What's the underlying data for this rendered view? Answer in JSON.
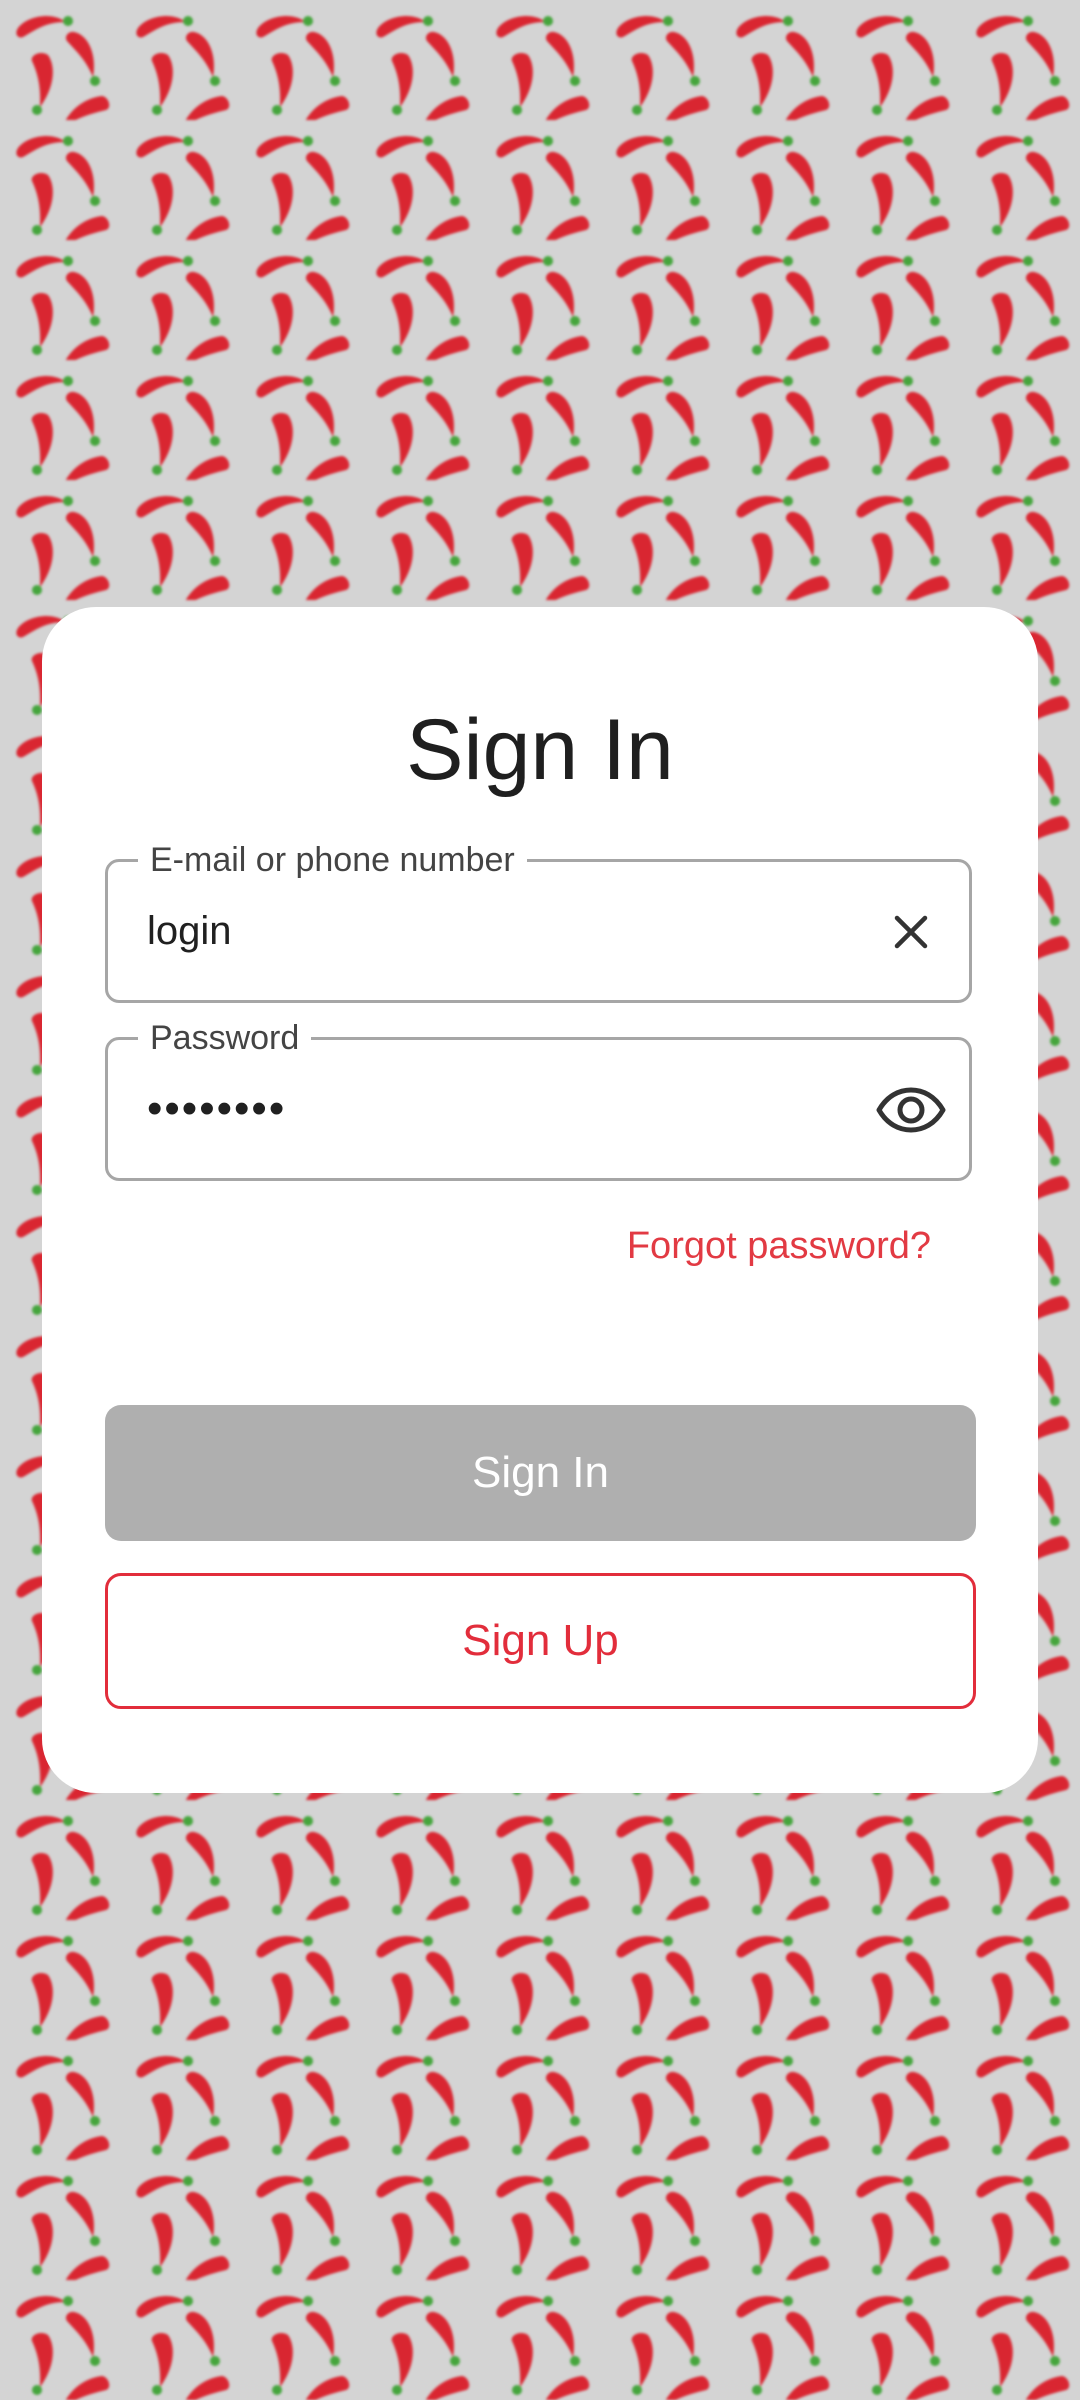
{
  "screen": {
    "title": "Sign In"
  },
  "form": {
    "email": {
      "label": "E-mail or phone number",
      "value": "login",
      "icon": "close-icon"
    },
    "password": {
      "label": "Password",
      "value": "••••••••",
      "icon": "visibility-icon"
    },
    "forgot_label": "Forgot password?"
  },
  "actions": {
    "sign_in_label": "Sign In",
    "sign_up_label": "Sign Up"
  },
  "colors": {
    "accent": "#e22d3b",
    "disabled_button": "#afafaf",
    "background": "#d4d4d4"
  }
}
